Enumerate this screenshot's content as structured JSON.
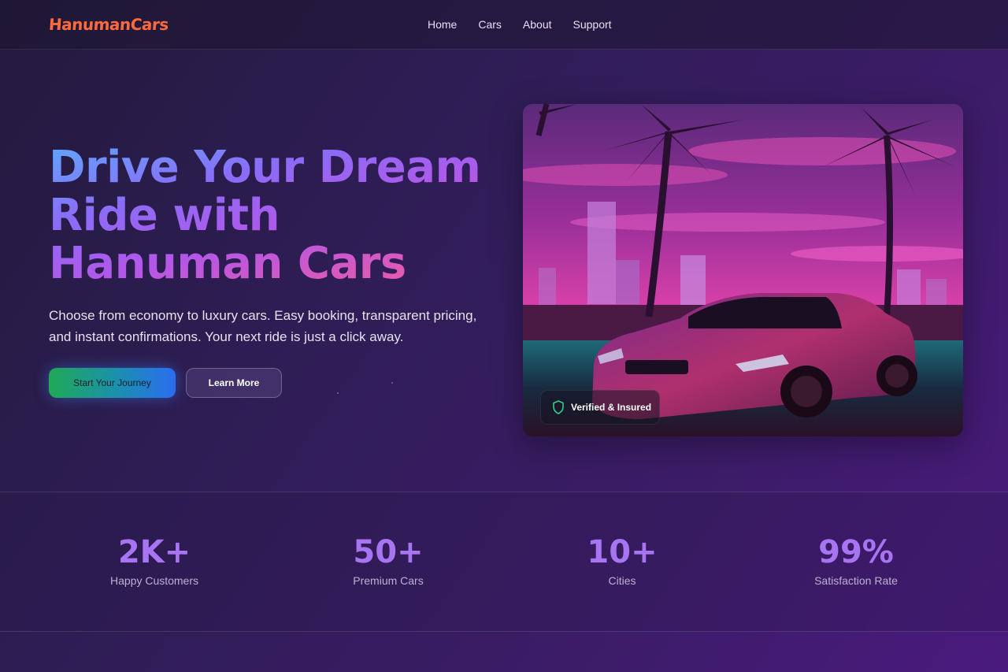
{
  "brand": {
    "name": "HanumanCars",
    "color": "#ff6a3d"
  },
  "nav": {
    "items": [
      "Home",
      "Cars",
      "About",
      "Support"
    ]
  },
  "hero": {
    "title_lines": [
      "Drive Your Dream",
      "Ride with",
      "Hanuman Cars"
    ],
    "subtitle": "Choose from economy to luxury cars. Easy booking, transparent pricing, and instant confirmations. Your next ride is just a click away.",
    "primary_button": "Start Your Journey",
    "secondary_button": "Learn More",
    "image_badge": {
      "icon": "shield-icon",
      "label": "Verified & Insured"
    }
  },
  "stats": [
    {
      "value": "2K+",
      "label": "Happy Customers"
    },
    {
      "value": "50+",
      "label": "Premium Cars"
    },
    {
      "value": "10+",
      "label": "Cities"
    },
    {
      "value": "99%",
      "label": "Satisfaction Rate"
    }
  ],
  "colors": {
    "accent": "#a774f2",
    "primary_gradient": [
      "#1faa55",
      "#2a6df0"
    ],
    "title_gradient": [
      "#5ea8ff",
      "#8b6cf7",
      "#b257e8",
      "#e45ab0"
    ]
  }
}
